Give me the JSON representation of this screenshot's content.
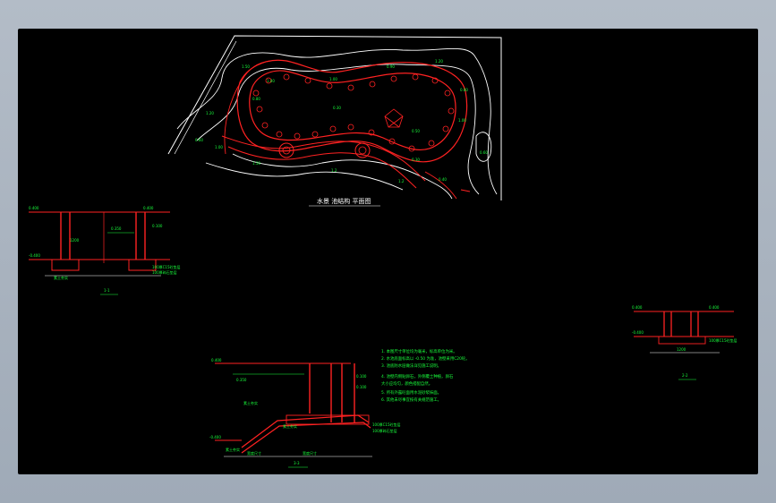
{
  "drawing": {
    "plan_title": "水景 池结构 平面图",
    "section_labels": {
      "a": "1-1",
      "b": "3-3",
      "c": "2-2"
    },
    "notes": [
      "1. 本图尺寸单位均为毫米，标高单位为米。",
      "2. 水池底面标高以 -0.50 为准，池壁采用C20砼。",
      "3. 池底防水层做法详见施工说明。",
      "4. 池壁内侧贴卵石，外侧覆土种植，卵石",
      "   大小应均匀，颜色搭配自然。",
      "5. 所有外露砼面用水泥砂浆抹面。",
      "6. 其他未尽事宜按有关规范施工。"
    ],
    "annotations": {
      "water_level": "0.350",
      "level_top": "0.400",
      "level_mid": "0.100",
      "level_bot": "-0.400",
      "base_note": "素土夯实",
      "layer_note_1": "100厚C15砼垫层",
      "layer_note_2": "100厚碎石垫层",
      "dim_a": "1200",
      "dim_b": "3000",
      "width_label": "宽度尺寸"
    },
    "colors": {
      "background": "#000000",
      "contour": "#ffffff",
      "structure": "#ff2222",
      "text": "#19ff3c"
    }
  }
}
